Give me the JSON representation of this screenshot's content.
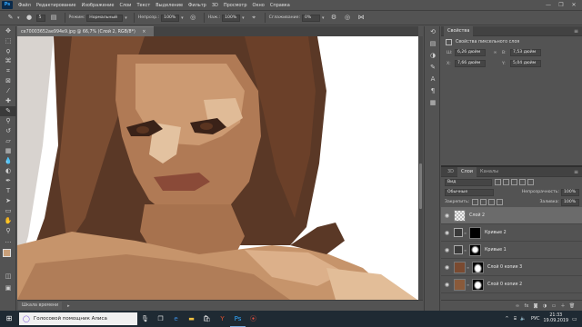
{
  "app": {
    "logo": "Ps",
    "menu": [
      "Файл",
      "Редактирование",
      "Изображение",
      "Слои",
      "Текст",
      "Выделение",
      "Фильтр",
      "3D",
      "Просмотр",
      "Окно",
      "Справка"
    ],
    "window_controls": [
      "—",
      "❐",
      "✕"
    ]
  },
  "options": {
    "mode_label": "Режим:",
    "mode_value": "Нормальный",
    "opacity_label": "Непрозр.:",
    "opacity_value": "100%",
    "flow_label": "Наж.:",
    "flow_value": "100%",
    "smoothing_label": "Сглаживание:",
    "smoothing_value": "0%",
    "size_value": "5"
  },
  "document": {
    "tab_title": "ce70003652ae994e9.jpg @ 66,7% (Слой 2, RGB/8*)",
    "close": "×"
  },
  "status": {
    "text": "Шкала времени"
  },
  "properties": {
    "tab": "Свойства",
    "sub_title": "Свойства пиксельного слоя",
    "w_label": "Ш:",
    "w_value": "6,26 дюйм",
    "h_label": "В:",
    "h_value": "7,53 дюйм",
    "x_label": "X:",
    "x_value": "7,66 дюйм",
    "y_label": "Y:",
    "y_value": "5,04 дюйм"
  },
  "layers": {
    "tabs": [
      "3D",
      "Слои",
      "Каналы"
    ],
    "filter_label": "Вид",
    "blend_mode": "Обычные",
    "opacity_label": "Непрозрачность:",
    "opacity_value": "100%",
    "lock_label": "Закрепить:",
    "fill_label": "Заливка:",
    "fill_value": "100%",
    "items": [
      {
        "name": "Слой 2"
      },
      {
        "name": "Кривые 2"
      },
      {
        "name": "Кривые 1"
      },
      {
        "name": "Слой 0 копия 3"
      },
      {
        "name": "Слой 0 копия 2"
      }
    ]
  },
  "taskbar": {
    "search_placeholder": "Голосовой помощник Алиса",
    "lang": "РУС",
    "time": "21:33",
    "date": "19.09.2019"
  },
  "colors": {
    "foreground": "#c9a07a",
    "background": "#ffffff",
    "ui_bg": "#535353",
    "taskbar": "#1f2a33"
  }
}
